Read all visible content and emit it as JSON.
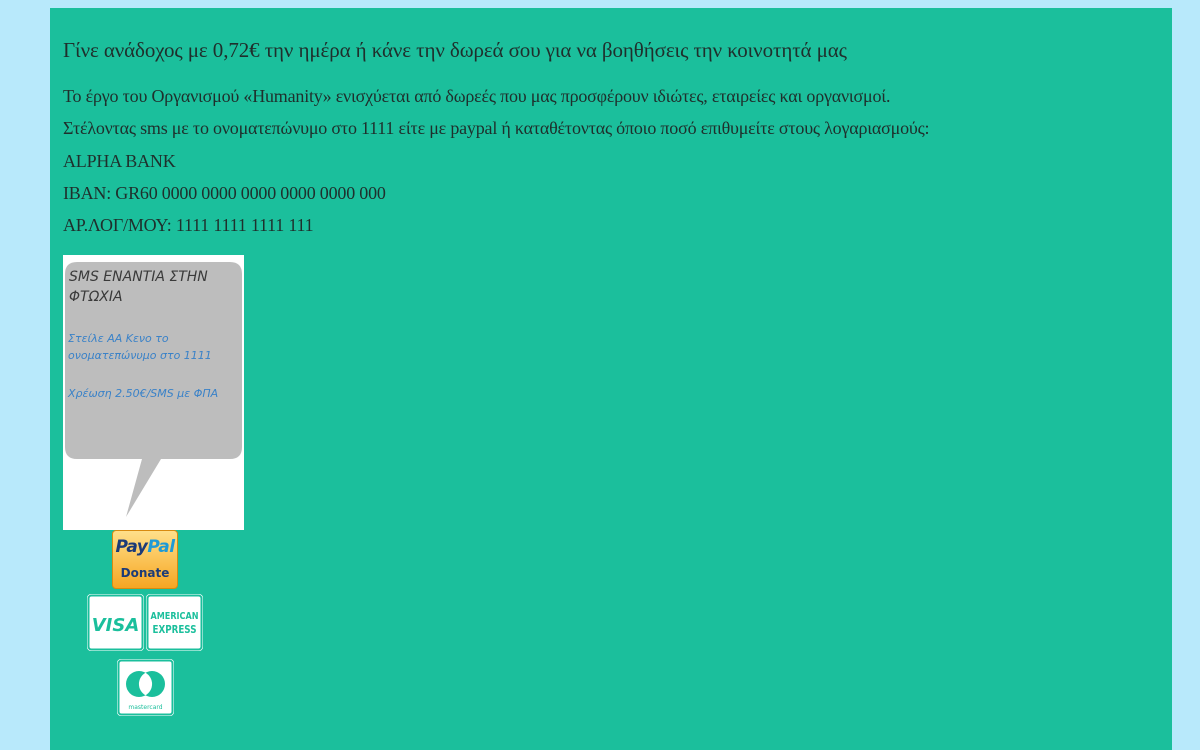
{
  "heading": "Γίνε ανάδοχος με 0,72€ την ημέρα ή κάνε την δωρεά σου για να βοηθήσεις την κοινοτητά μας",
  "paragraphs": [
    "Το έργο του Οργανισμού «Humanity» ενισχύεται από δωρεές που μας προσφέρουν ιδιώτες, εταιρείες και οργανισμοί.",
    "Στέλοντας sms με το ονοματεπώνυμο στο 1111 είτε με paypal ή καταθέτοντας όποιο ποσό επιθυμείτε στους λογαριασμούς:",
    "ALPHA BANK",
    "IBAN: GR60 0000 0000 0000 0000 0000 000",
    "ΑΡ.ΛΟΓ/ΜΟΥ: 1111 1111 1111 111"
  ],
  "sms_card": {
    "title": "SMS ΕΝΑΝΤΙΑ ΣΤΗΝ ΦΤΩΧΙΑ",
    "instruction": " Στείλε ΑΑ Κενο το ονοματεπώνυμο στο 1111",
    "charge": "Χρέωση 2.50€/SMS με ΦΠΑ"
  },
  "paypal_button": {
    "pay": "Pay",
    "pal": "Pal",
    "donate": "Donate"
  },
  "payment_icons": {
    "visa": "VISA",
    "amex_line1": "AMERICAN",
    "amex_line2": "EXPRESS",
    "mastercard": "mastercard"
  },
  "colors": {
    "page_background": "#b8e9fb",
    "panel_background": "#1bbf9c",
    "bubble_gray": "#bdbdbd",
    "sms_text_blue": "#3a82c8"
  }
}
